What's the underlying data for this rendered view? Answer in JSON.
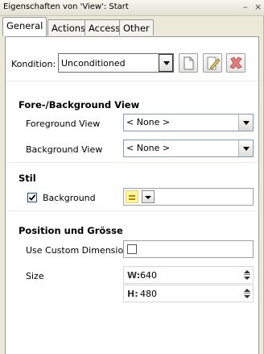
{
  "window": {
    "title": "Eigenschaften von 'View': Start",
    "minimize_glyph": "–",
    "close_glyph": "×"
  },
  "tabs": [
    {
      "label": "General",
      "active": true
    },
    {
      "label": "Actions",
      "active": false
    },
    {
      "label": "Access",
      "active": false
    },
    {
      "label": "Other",
      "active": false
    }
  ],
  "condition": {
    "label": "Kondition:",
    "value": "Unconditioned",
    "buttons": [
      "new-icon",
      "edit-icon",
      "delete-icon"
    ]
  },
  "fore_background": {
    "heading": "Fore-/Background View",
    "foreground_label": "Foreground View",
    "foreground_value": "< None >",
    "background_label": "Background View",
    "background_value": "< None >"
  },
  "stil": {
    "heading": "Stil",
    "background_label": "Background",
    "background_checked": true,
    "swatch_color": "#fff59a"
  },
  "position": {
    "heading": "Position und Grösse",
    "custom_dimension_label": "Use Custom Dimension",
    "custom_dimension_checked": false,
    "size_label": "Size",
    "width_label": "W:",
    "width_value": "640",
    "height_label": "H:",
    "height_value": "480"
  }
}
